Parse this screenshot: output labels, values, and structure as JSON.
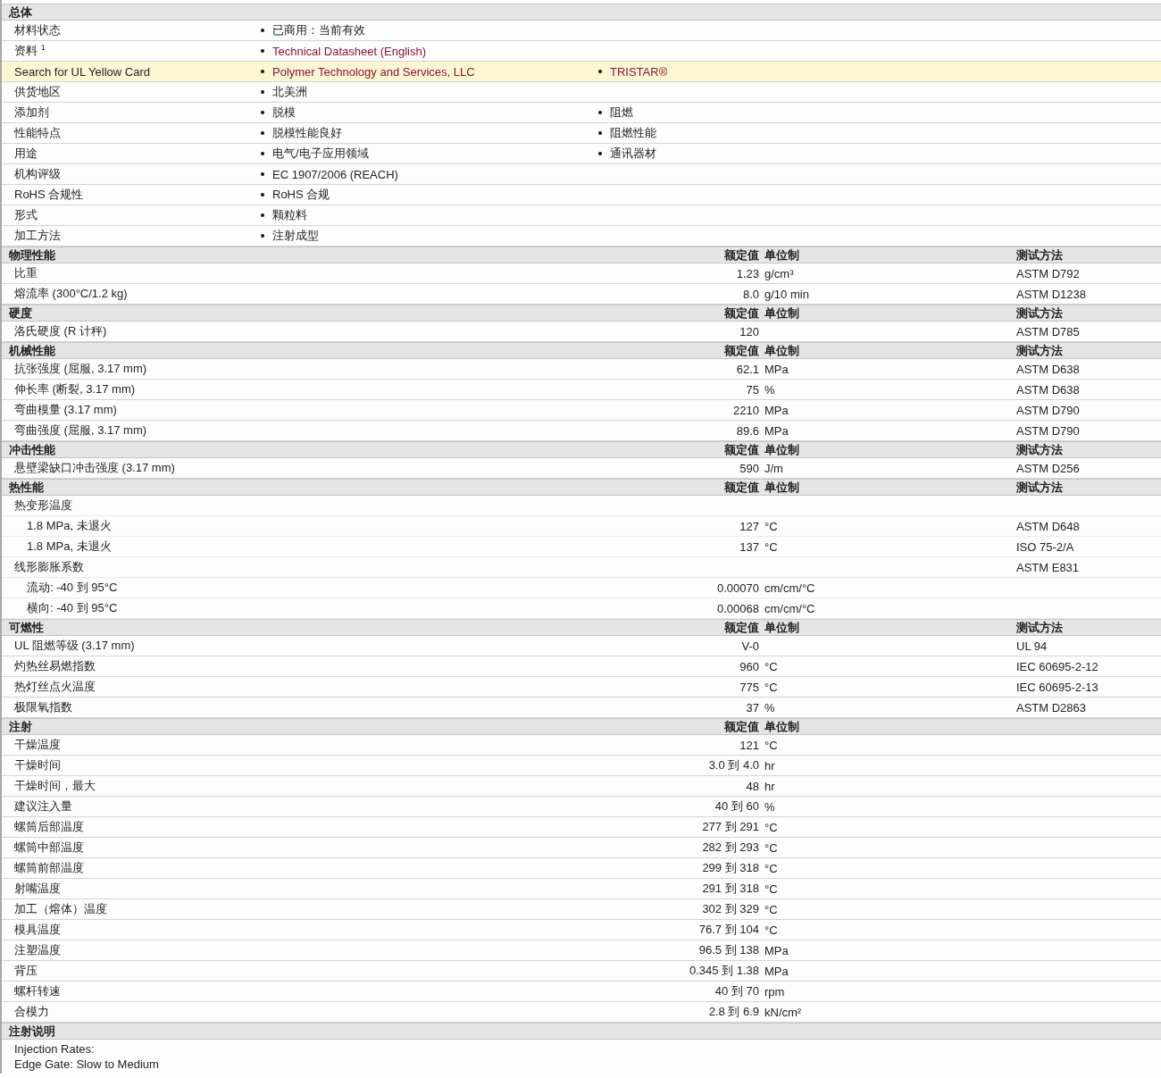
{
  "general": {
    "title": "总体",
    "rows": [
      {
        "label": "材料状态",
        "highlighted": false,
        "items": [
          {
            "text": "已商用：当前有效",
            "link": false
          }
        ]
      },
      {
        "label": "资料 $^{1}$",
        "highlighted": false,
        "items": [
          {
            "text": "Technical Datasheet (English)",
            "link": true
          }
        ]
      },
      {
        "label": "Search for UL Yellow Card",
        "highlighted": true,
        "items": [
          {
            "text": "Polymer Technology and Services, LLC",
            "link": true
          },
          {
            "text": "TRISTAR®",
            "link": true
          }
        ]
      },
      {
        "label": "供货地区",
        "highlighted": false,
        "items": [
          {
            "text": "北美洲",
            "link": false
          }
        ]
      },
      {
        "label": "添加剂",
        "highlighted": false,
        "items": [
          {
            "text": "脱模",
            "link": false
          },
          {
            "text": "阻燃",
            "link": false
          }
        ]
      },
      {
        "label": "性能特点",
        "highlighted": false,
        "items": [
          {
            "text": "脱模性能良好",
            "link": false
          },
          {
            "text": "阻燃性能",
            "link": false
          }
        ]
      },
      {
        "label": "用途",
        "highlighted": false,
        "items": [
          {
            "text": "电气/电子应用领域",
            "link": false
          },
          {
            "text": "通讯器材",
            "link": false
          }
        ]
      },
      {
        "label": "机构评级",
        "highlighted": false,
        "items": [
          {
            "text": "EC 1907/2006 (REACH)",
            "link": false
          }
        ]
      },
      {
        "label": "RoHS 合规性",
        "highlighted": false,
        "items": [
          {
            "text": "RoHS 合规",
            "link": false
          }
        ]
      },
      {
        "label": "形式",
        "highlighted": false,
        "items": [
          {
            "text": "颗粒料",
            "link": false
          }
        ]
      },
      {
        "label": "加工方法",
        "highlighted": false,
        "items": [
          {
            "text": "注射成型",
            "link": false
          }
        ]
      }
    ]
  },
  "sections": [
    {
      "title": "物理性能",
      "value_header": "额定值",
      "unit_header": "单位制",
      "method_header": "测试方法",
      "rows": [
        {
          "name": "比重",
          "value": "1.23",
          "unit": "g/cm³",
          "method": "ASTM D792"
        },
        {
          "name": "熔流率 (300°C/1.2 kg)",
          "value": "8.0",
          "unit": "g/10 min",
          "method": "ASTM D1238"
        }
      ]
    },
    {
      "title": "硬度",
      "value_header": "额定值",
      "unit_header": "单位制",
      "method_header": "测试方法",
      "rows": [
        {
          "name": "洛氏硬度 (R 计秤)",
          "value": "120",
          "method": "ASTM D785"
        }
      ]
    },
    {
      "title": "机械性能",
      "value_header": "额定值",
      "unit_header": "单位制",
      "method_header": "测试方法",
      "rows": [
        {
          "name": "抗张强度 (屈服, 3.17 mm)",
          "value": "62.1",
          "unit": "MPa",
          "method": "ASTM D638"
        },
        {
          "name": "伸长率 (断裂, 3.17 mm)",
          "value": "75",
          "unit": "%",
          "method": "ASTM D638"
        },
        {
          "name": "弯曲模量 (3.17 mm)",
          "value": "2210",
          "unit": "MPa",
          "method": "ASTM D790"
        },
        {
          "name": "弯曲强度 (屈服, 3.17 mm)",
          "value": "89.6",
          "unit": "MPa",
          "method": "ASTM D790"
        }
      ]
    },
    {
      "title": "冲击性能",
      "value_header": "额定值",
      "unit_header": "单位制",
      "method_header": "测试方法",
      "rows": [
        {
          "name": "悬壁梁缺口冲击强度 (3.17 mm)",
          "value": "590",
          "unit": "J/m",
          "method": "ASTM D256"
        }
      ]
    },
    {
      "title": "热性能",
      "value_header": "额定值",
      "unit_header": "单位制",
      "method_header": "测试方法",
      "rows": [
        {
          "name": "热变形温度",
          "children": [
            {
              "name": "1.8 MPa, 未退火",
              "value": "127",
              "unit": "°C",
              "method": "ASTM D648"
            },
            {
              "name": "1.8 MPa, 未退火",
              "value": "137",
              "unit": "°C",
              "method": "ISO 75-2/A"
            }
          ]
        },
        {
          "name": "线形膨胀系数",
          "method": "ASTM E831",
          "children": [
            {
              "name": "流动: -40 到 95°C",
              "value": "0.00070",
              "unit": "cm/cm/°C"
            },
            {
              "name": "横向: -40 到 95°C",
              "value": "0.00068",
              "unit": "cm/cm/°C"
            }
          ]
        }
      ]
    },
    {
      "title": "可燃性",
      "value_header": "额定值",
      "unit_header": "单位制",
      "method_header": "测试方法",
      "rows": [
        {
          "name": "UL 阻燃等级 (3.17 mm)",
          "value": "V-0",
          "method": "UL 94"
        },
        {
          "name": "灼热丝易燃指数",
          "value": "960",
          "unit": "°C",
          "method": "IEC 60695-2-12"
        },
        {
          "name": "热灯丝点火温度",
          "value": "775",
          "unit": "°C",
          "method": "IEC 60695-2-13"
        },
        {
          "name": "极限氧指数",
          "value": "37",
          "unit": "%",
          "method": "ASTM D2863"
        }
      ]
    },
    {
      "title": "注射",
      "value_header": "额定值",
      "unit_header": "单位制",
      "rows": [
        {
          "name": "干燥温度",
          "value": "121",
          "unit": "°C"
        },
        {
          "name": "干燥时间",
          "value": "3.0 到 4.0",
          "unit": "hr"
        },
        {
          "name": "干燥时间，最大",
          "value": "48",
          "unit": "hr"
        },
        {
          "name": "建议注入量",
          "value": "40 到 60",
          "unit": "%"
        },
        {
          "name": "螺筒后部温度",
          "value": "277 到 291",
          "unit": "°C"
        },
        {
          "name": "螺筒中部温度",
          "value": "282 到 293",
          "unit": "°C"
        },
        {
          "name": "螺筒前部温度",
          "value": "299 到 318",
          "unit": "°C"
        },
        {
          "name": "射嘴温度",
          "value": "291 到 318",
          "unit": "°C"
        },
        {
          "name": "加工（熔体）温度",
          "value": "302 到 329",
          "unit": "°C"
        },
        {
          "name": "模具温度",
          "value": "76.7 到 104",
          "unit": "°C"
        },
        {
          "name": "注塑温度",
          "value": "96.5 到 138",
          "unit": "MPa"
        },
        {
          "name": "背压",
          "value": "0.345 到 1.38",
          "unit": "MPa"
        },
        {
          "name": "螺杆转速",
          "value": "40 到 70",
          "unit": "rpm"
        },
        {
          "name": "合模力",
          "value": "2.8 到 6.9",
          "unit": "kN/cm²"
        }
      ]
    }
  ],
  "notes": {
    "title": "注射说明",
    "lines": [
      "Injection Rates:",
      "Edge Gate: Slow to Medium"
    ]
  }
}
